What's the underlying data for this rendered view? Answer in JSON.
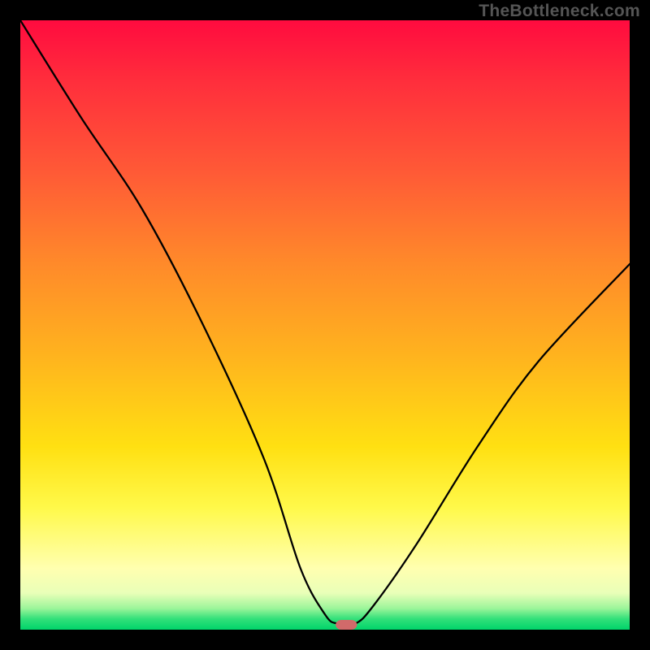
{
  "watermark": "TheBottleneck.com",
  "chart_data": {
    "type": "line",
    "title": "",
    "xlabel": "",
    "ylabel": "",
    "xlim": [
      0,
      100
    ],
    "ylim": [
      0,
      100
    ],
    "series": [
      {
        "name": "bottleneck-curve",
        "x": [
          0,
          10,
          20,
          30,
          40,
          46,
          50,
          52,
          55,
          58,
          65,
          75,
          85,
          100
        ],
        "y": [
          100,
          84,
          69,
          50,
          28,
          10,
          2.5,
          1,
          1,
          4,
          14,
          30,
          44,
          60
        ]
      }
    ],
    "marker": {
      "x": 53.5,
      "y": 0.8,
      "w": 3.5,
      "h": 1.6
    },
    "gradient_stops_pct": [
      {
        "pct": 0,
        "color": "#ff0b3f"
      },
      {
        "pct": 55,
        "color": "#ffb31e"
      },
      {
        "pct": 80,
        "color": "#fff94a"
      },
      {
        "pct": 100,
        "color": "#00d46a"
      }
    ]
  }
}
